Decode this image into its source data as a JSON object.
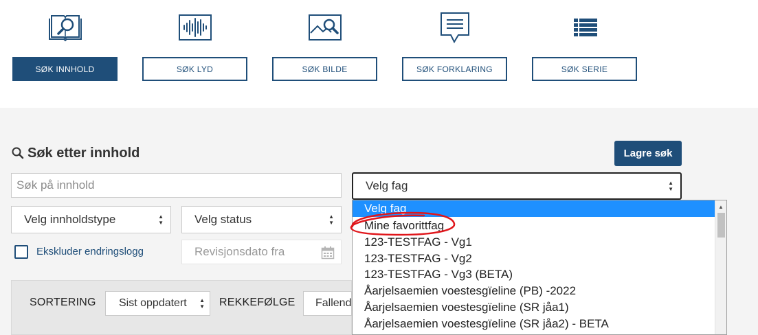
{
  "tabs": [
    {
      "label": "SØK INNHOLD",
      "icon": "book-search-icon",
      "active": true
    },
    {
      "label": "SØK LYD",
      "icon": "audio-wave-icon",
      "active": false
    },
    {
      "label": "SØK BILDE",
      "icon": "image-search-icon",
      "active": false
    },
    {
      "label": "SØK FORKLARING",
      "icon": "speech-bubble-icon",
      "active": false
    },
    {
      "label": "SØK SERIE",
      "icon": "list-icon",
      "active": false
    }
  ],
  "search": {
    "title": "Søk etter innhold",
    "save_label": "Lagre søk",
    "content_placeholder": "Søk på innhold",
    "subject_select": "Velg fag",
    "content_type_select": "Velg innholdstype",
    "status_select": "Velg status",
    "exclude_changelog_label": "Ekskluder endringslogg",
    "revision_date_placeholder": "Revisjonsdato fra"
  },
  "sorting": {
    "sort_label": "SORTERING",
    "sort_value": "Sist oppdatert",
    "order_label": "REKKEFØLGE",
    "order_value": "Fallend"
  },
  "subject_dropdown": {
    "options": [
      "Velg fag",
      "Mine favorittfag",
      "123-TESTFAG - Vg1",
      "123-TESTFAG - Vg2",
      "123-TESTFAG - Vg3 (BETA)",
      "Åarjelsaemien voestesgïeline (PB) -2022",
      "Åarjelsaemien voestesgïeline (SR jåa1)",
      "Åarjelsaemien voestesgïeline (SR jåa2) - BETA"
    ],
    "selected_index": 0,
    "highlight_color": "#1e90ff"
  },
  "colors": {
    "brand": "#1f4e79",
    "annotation": "#e0161b"
  }
}
